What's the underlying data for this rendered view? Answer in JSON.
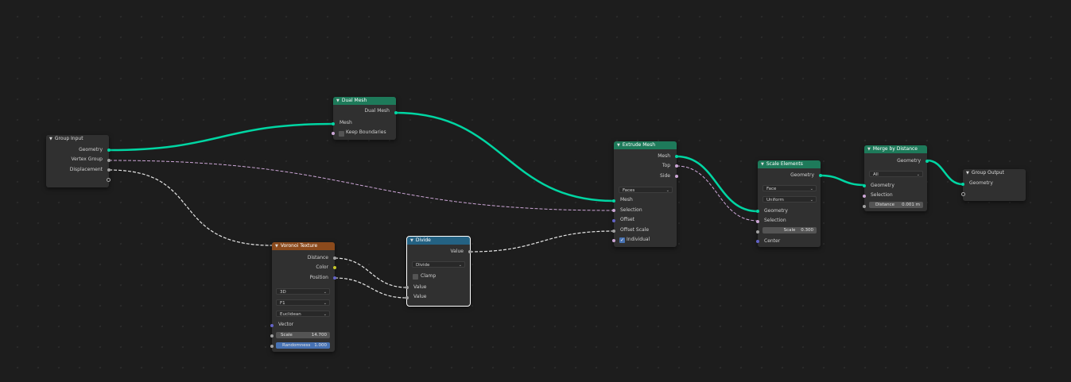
{
  "colors": {
    "background": "#1d1d1d",
    "geometry_socket": "#00d6a3",
    "geometry_node_header": "#1e7a5a",
    "texture_node_header": "#8b4a1c",
    "converter_node_header": "#246283",
    "field_highlight": "#4772b3"
  },
  "icons": {
    "collapse": "chevron-down-icon",
    "check": "checkmark-icon"
  },
  "nodes": {
    "group_input": {
      "title": "Group Input",
      "out_geometry": "Geometry",
      "out_vertex_group": "Vertex Group",
      "out_displacement": "Displacement"
    },
    "dual_mesh": {
      "title": "Dual Mesh",
      "out_dual_mesh": "Dual Mesh",
      "in_mesh": "Mesh",
      "keep_boundaries": "Keep Boundaries"
    },
    "voronoi": {
      "title": "Voronoi Texture",
      "out_distance": "Distance",
      "out_color": "Color",
      "out_position": "Position",
      "dim": "3D",
      "feature": "F1",
      "metric": "Euclidean",
      "in_vector": "Vector",
      "scale_label": "Scale",
      "scale_value": "14.700",
      "randomness_label": "Randomness",
      "randomness_value": "1.000"
    },
    "divide": {
      "title": "Divide",
      "out_value": "Value",
      "operation": "Divide",
      "clamp": "Clamp",
      "in_value1": "Value",
      "in_value2": "Value"
    },
    "extrude": {
      "title": "Extrude Mesh",
      "out_mesh": "Mesh",
      "out_top": "Top",
      "out_side": "Side",
      "mode": "Faces",
      "in_mesh": "Mesh",
      "in_selection": "Selection",
      "in_offset": "Offset",
      "in_offset_scale": "Offset Scale",
      "individual": "Individual"
    },
    "scale_elements": {
      "title": "Scale Elements",
      "out_geometry": "Geometry",
      "domain": "Face",
      "scale_mode": "Uniform",
      "in_geometry": "Geometry",
      "in_selection": "Selection",
      "scale_label": "Scale",
      "scale_value": "0.300",
      "in_center": "Center"
    },
    "merge": {
      "title": "Merge by Distance",
      "out_geometry": "Geometry",
      "mode": "All",
      "in_geometry": "Geometry",
      "in_selection": "Selection",
      "distance_label": "Distance",
      "distance_value": "0.001 m"
    },
    "group_output": {
      "title": "Group Output",
      "in_geometry": "Geometry"
    }
  }
}
